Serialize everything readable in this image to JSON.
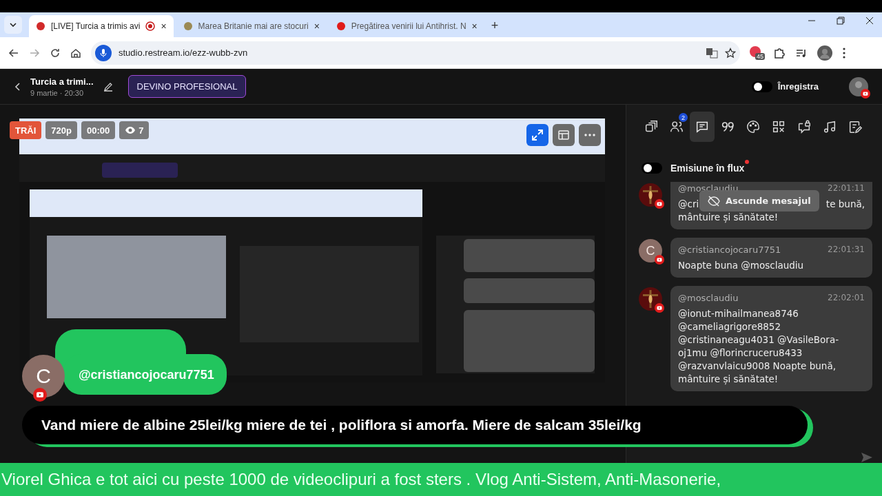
{
  "browser": {
    "tabs": [
      {
        "title": "[LIVE] Turcia a trimis avi",
        "selected": true,
        "recording": true,
        "close": "×"
      },
      {
        "title": "Marea Britanie mai are stocuri",
        "selected": false,
        "recording": false,
        "close": "×"
      },
      {
        "title": "Pregătirea venirii lui Antihrist. N",
        "selected": false,
        "recording": false,
        "close": "×"
      }
    ],
    "new_tab": "+",
    "url": "studio.restream.io/ezz-wubb-zvn",
    "extension_badge": "45"
  },
  "header": {
    "title": "Turcia a trimi...",
    "date": "9 martie · 20:30",
    "upgrade_button": "DEVINO PROFESIONAL",
    "record": {
      "label": "Înregistra",
      "on": false
    }
  },
  "preview": {
    "badges": [
      {
        "kind": "live",
        "label": "TRĂI"
      },
      {
        "kind": "plain",
        "label": "720p"
      },
      {
        "kind": "plain",
        "label": "00:00"
      },
      {
        "kind": "viewers",
        "label": "7"
      }
    ]
  },
  "panel": {
    "tabs": [
      {
        "kind": "windows",
        "selected": false
      },
      {
        "kind": "people",
        "selected": false,
        "badge": "2"
      },
      {
        "kind": "chat",
        "selected": true
      },
      {
        "kind": "quote",
        "selected": false
      },
      {
        "kind": "palette",
        "selected": false
      },
      {
        "kind": "qr",
        "selected": false
      },
      {
        "kind": "chat-lock",
        "selected": false
      },
      {
        "kind": "music",
        "selected": false
      },
      {
        "kind": "note",
        "selected": false
      }
    ],
    "stream_toggle": {
      "label": "Emisiune în flux",
      "on": false,
      "alert": true
    },
    "messages": [
      {
        "kind": "covered",
        "user": "@mosclaudiu",
        "time": "22:01:11",
        "before": "@cri",
        "after": "te bună,",
        "rest": "mântuire și sănătate!",
        "tooltip": "Ascunde mesajul"
      },
      {
        "kind": "plain",
        "letter": "C",
        "user": "@cristiancojocaru7751",
        "time": "22:01:31",
        "text": "Noapte buna @mosclaudiu"
      },
      {
        "kind": "plain",
        "user": "@mosclaudiu",
        "time": "22:02:01",
        "text": "@ionut-mihailmanea8746 @cameliagrigore8852 @cristinaneagu4031 @VasileBora-oj1mu @florincruceru8433 @razvanvlaicu9008 Noapte bună, mântuire și sănătate!"
      }
    ]
  },
  "overlay": {
    "comment": {
      "letter": "C",
      "user": "@cristiancojocaru7751",
      "text": "Vand miere de albine 25lei/kg miere de tei , poliflora si amorfa. Miere de salcam 35lei/kg"
    },
    "ticker": "Viorel Ghica e tot aici cu peste 1000 de videoclipuri a fost sters . Vlog Anti-Sistem, Anti-Masonerie,"
  }
}
